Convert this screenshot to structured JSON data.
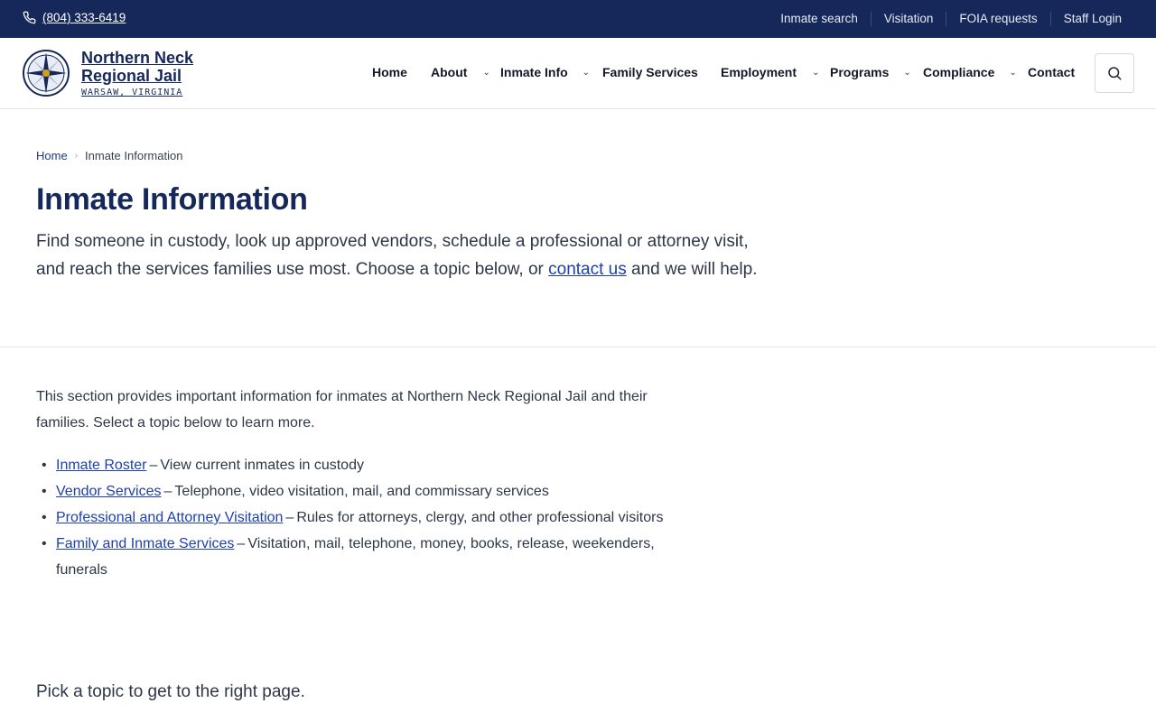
{
  "topbar": {
    "phone": "(804) 333-6419",
    "utility_links": [
      "Inmate search",
      "Visitation",
      "FOIA requests",
      "Staff Login"
    ],
    "bg_color": "#16285a"
  },
  "brand": {
    "name": "Northern Neck Regional Jail",
    "location": "WARSAW, VIRGINIA"
  },
  "nav": {
    "home": "Home",
    "about": "About",
    "inmate_info": "Inmate Info",
    "family_services": "Family Services",
    "employment": "Employment",
    "programs": "Programs",
    "compliance": "Compliance",
    "contact": "Contact",
    "dropdown_icon": "chevron-down-icon"
  },
  "breadcrumb": {
    "home": "Home",
    "current": "Inmate Information"
  },
  "hero": {
    "title": "Inmate Information",
    "intro_text": "Find someone in custody, look up approved vendors, schedule a professional or attorney visit, and reach the services families use most. Choose a topic below, or",
    "intro_link": "contact us",
    "intro_tail": "and we will help."
  },
  "content": {
    "lead": "This section provides important information for inmates at Northern Neck Regional Jail and their families. Select a topic below to learn more.",
    "topics": [
      {
        "link": "Inmate Roster",
        "desc": "View current inmates in custody"
      },
      {
        "link": "Vendor Services",
        "desc": "Telephone, video visitation, mail, and commissary services"
      },
      {
        "link": "Professional and Attorney Visitation",
        "desc": "Rules for attorneys, clergy, and other professional visitors"
      },
      {
        "link": "Family and Inmate Services",
        "desc": "Visitation, mail, telephone, money, books, release, weekenders, funerals"
      }
    ],
    "separator": "–",
    "pick_prompt": "Pick a topic to get to the right page."
  }
}
